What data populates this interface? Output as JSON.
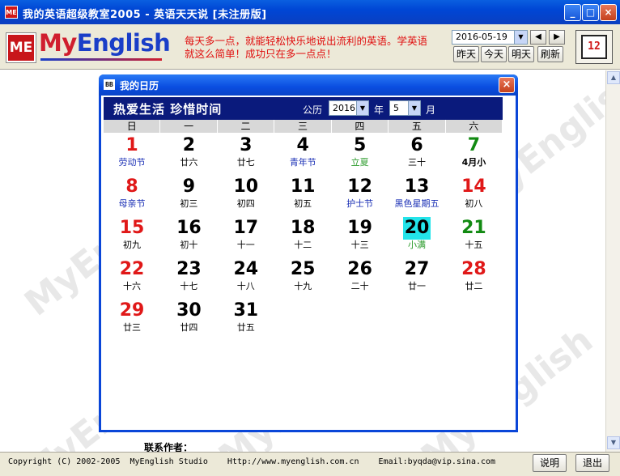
{
  "window": {
    "title": "我的英语超级教室2005 - 英语天天说 [未注册版]",
    "icon_label": "ME",
    "controls": [
      "_",
      "□",
      "×"
    ]
  },
  "toolbar": {
    "logo_badge": "ME",
    "logo_my": "My",
    "logo_english": "English",
    "slogan": "每天多一点，就能轻松快乐地说出流利的英语。学英语就这么简单！成功只在多一点点！",
    "date_value": "2016-05-19",
    "prev_label": "◀",
    "next_label": "▶",
    "buttons": {
      "yesterday": "昨天",
      "today": "今天",
      "tomorrow": "明天",
      "refresh": "刷新"
    },
    "book_digits": "12"
  },
  "watermark": "MyEnglish",
  "calendar": {
    "title": "我的日历",
    "icon_label": "BB",
    "close": "×",
    "motto": "热爱生活 珍惜时间",
    "gregorian_label": "公历",
    "year": "2016",
    "year_label": "年",
    "month": "5",
    "month_label": "月",
    "weekdays": [
      "日",
      "一",
      "二",
      "三",
      "四",
      "五",
      "六"
    ],
    "colors": {
      "red": "#e01818",
      "black": "#000000",
      "green": "#128a12",
      "blue": "#1a2fb5",
      "festival_green": "#2a9a2a"
    },
    "days": [
      {
        "d": "1",
        "l": "劳动节",
        "c": "red",
        "lc": "blue"
      },
      {
        "d": "2",
        "l": "廿六",
        "c": "black",
        "lc": "black"
      },
      {
        "d": "3",
        "l": "廿七",
        "c": "black",
        "lc": "black"
      },
      {
        "d": "4",
        "l": "青年节",
        "c": "black",
        "lc": "blue"
      },
      {
        "d": "5",
        "l": "立夏",
        "c": "black",
        "lc": "festival_green"
      },
      {
        "d": "6",
        "l": "三十",
        "c": "black",
        "lc": "black"
      },
      {
        "d": "7",
        "l": "4月小",
        "c": "green",
        "lc": "black",
        "bold": true
      },
      {
        "d": "8",
        "l": "母亲节",
        "c": "red",
        "lc": "blue"
      },
      {
        "d": "9",
        "l": "初三",
        "c": "black",
        "lc": "black"
      },
      {
        "d": "10",
        "l": "初四",
        "c": "black",
        "lc": "black"
      },
      {
        "d": "11",
        "l": "初五",
        "c": "black",
        "lc": "black"
      },
      {
        "d": "12",
        "l": "护士节",
        "c": "black",
        "lc": "blue"
      },
      {
        "d": "13",
        "l": "黑色星期五",
        "c": "black",
        "lc": "blue"
      },
      {
        "d": "14",
        "l": "初八",
        "c": "red",
        "lc": "black"
      },
      {
        "d": "15",
        "l": "初九",
        "c": "red",
        "lc": "black"
      },
      {
        "d": "16",
        "l": "初十",
        "c": "black",
        "lc": "black"
      },
      {
        "d": "17",
        "l": "十一",
        "c": "black",
        "lc": "black"
      },
      {
        "d": "18",
        "l": "十二",
        "c": "black",
        "lc": "black"
      },
      {
        "d": "19",
        "l": "十三",
        "c": "black",
        "lc": "black"
      },
      {
        "d": "20",
        "l": "小满",
        "c": "black",
        "lc": "festival_green",
        "today": true
      },
      {
        "d": "21",
        "l": "十五",
        "c": "green",
        "lc": "black"
      },
      {
        "d": "22",
        "l": "十六",
        "c": "red",
        "lc": "black"
      },
      {
        "d": "23",
        "l": "十七",
        "c": "black",
        "lc": "black"
      },
      {
        "d": "24",
        "l": "十八",
        "c": "black",
        "lc": "black"
      },
      {
        "d": "25",
        "l": "十九",
        "c": "black",
        "lc": "black"
      },
      {
        "d": "26",
        "l": "二十",
        "c": "black",
        "lc": "black"
      },
      {
        "d": "27",
        "l": "廿一",
        "c": "black",
        "lc": "black"
      },
      {
        "d": "28",
        "l": "廿二",
        "c": "red",
        "lc": "black"
      },
      {
        "d": "29",
        "l": "廿三",
        "c": "red",
        "lc": "black"
      },
      {
        "d": "30",
        "l": "廿四",
        "c": "black",
        "lc": "black"
      },
      {
        "d": "31",
        "l": "廿五",
        "c": "black",
        "lc": "black"
      }
    ]
  },
  "contact_label": "联系作者：",
  "status": {
    "copyright": "Copyright (C) 2002-2005  MyEnglish Studio    Http://www.myenglish.com.cn    Email:byqda@vip.sina.com",
    "help": "说明",
    "exit": "退出"
  }
}
